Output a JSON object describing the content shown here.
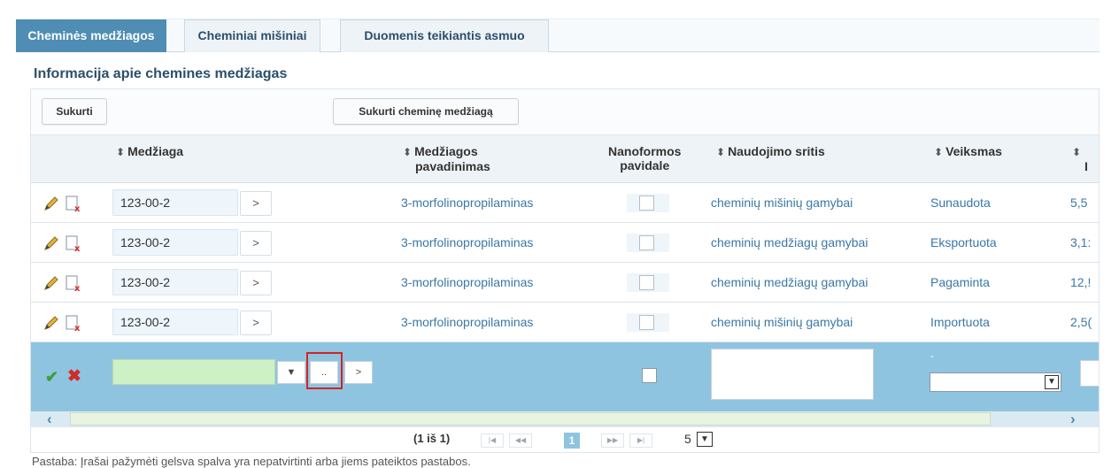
{
  "tabs": [
    {
      "label": "Cheminės medžiagos",
      "active": true
    },
    {
      "label": "Cheminiai mišiniai",
      "active": false
    },
    {
      "label": "Duomenis teikiantis asmuo",
      "active": false
    }
  ],
  "section_title": "Informacija apie chemines medžiagas",
  "toolbar": {
    "create_label": "Sukurti",
    "create_substance_label": "Sukurti cheminę medžiagą"
  },
  "columns": {
    "substance": "Medžiaga",
    "name_line1": "Medžiagos",
    "name_line2": "pavadinimas",
    "nano_line1": "Nanoformos",
    "nano_line2": "pavidale",
    "usage": "Naudojimo sritis",
    "action": "Veiksmas",
    "partial_line1": "",
    "partial_line2": "I"
  },
  "rows": [
    {
      "code": "123-00-2",
      "go": ">",
      "name": "3-morfolinopropilaminas",
      "usage": "cheminių mišinių gamybai",
      "action": "Sunaudota",
      "amount": "5,5"
    },
    {
      "code": "123-00-2",
      "go": ">",
      "name": "3-morfolinopropilaminas",
      "usage": "cheminių medžiagų gamybai",
      "action": "Eksportuota",
      "amount": "3,1:"
    },
    {
      "code": "123-00-2",
      "go": ">",
      "name": "3-morfolinopropilaminas",
      "usage": "cheminių medžiagų gamybai",
      "action": "Pagaminta",
      "amount": "12,!"
    },
    {
      "code": "123-00-2",
      "go": ">",
      "name": "3-morfolinopropilaminas",
      "usage": "cheminių mišinių gamybai",
      "action": "Importuota",
      "amount": "2,5("
    }
  ],
  "edit_row": {
    "dropdown_glyph": "▼",
    "ellipsis_label": "..",
    "go_label": ">",
    "action_placeholder": "-",
    "select_arrow": "▼"
  },
  "scroll": {
    "left": "‹",
    "right": "›"
  },
  "pager": {
    "summary": "(1 iš 1)",
    "first": "|◀",
    "prev": "◀◀",
    "current": "1",
    "next": "▶▶",
    "last": "▶|",
    "page_size": "5",
    "page_size_arrow": "▼"
  },
  "note": "Pastaba: Įrašai pažymėti gelsva spalva yra nepatvirtinti arba jiems pateiktos pastabos."
}
